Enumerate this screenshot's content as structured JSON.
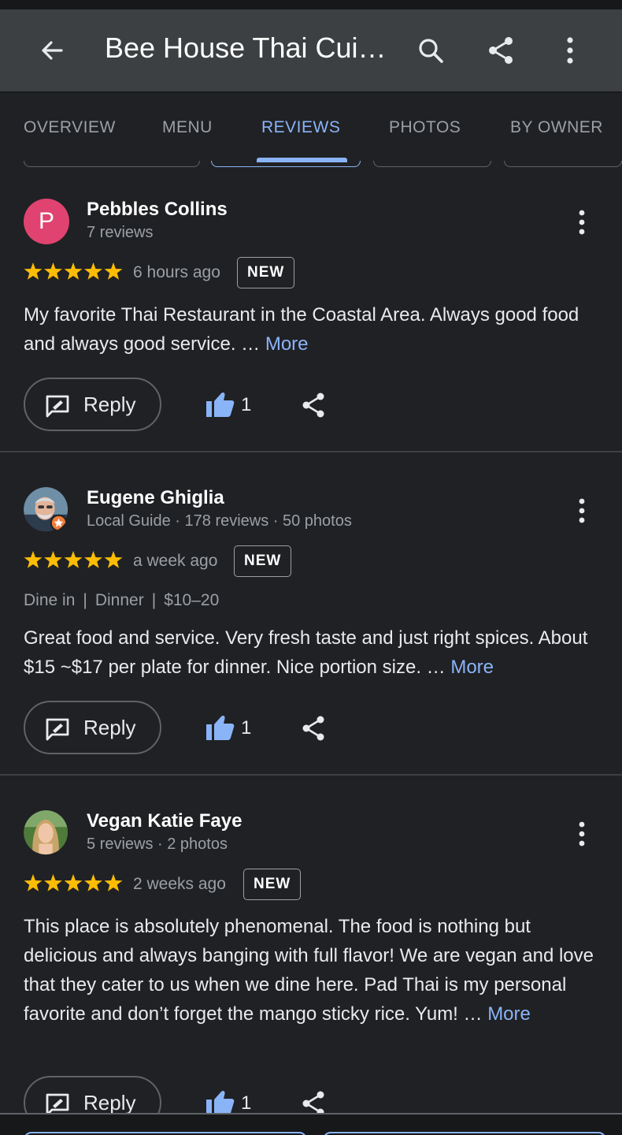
{
  "header": {
    "title": "Bee House Thai Cui…",
    "back_icon": "arrow-back-icon",
    "actions": [
      "search-icon",
      "share-icon",
      "more-vert-icon"
    ]
  },
  "tabs": [
    {
      "label": "OVERVIEW",
      "active": false
    },
    {
      "label": "MENU",
      "active": false
    },
    {
      "label": "REVIEWS",
      "active": true
    },
    {
      "label": "PHOTOS",
      "active": false
    },
    {
      "label": "BY OWNER",
      "active": false
    }
  ],
  "colors": {
    "accent": "#8ab4f8",
    "star": "#fbbc04",
    "avatar_p": "#e0436f",
    "background": "#202124",
    "appbar": "#3c4043"
  },
  "reviews": [
    {
      "avatar_letter": "P",
      "name": "Pebbles Collins",
      "meta": "7 reviews",
      "rating": 5,
      "time": "6 hours ago",
      "badge": "NEW",
      "text": "My favorite Thai Restaurant in the Coastal Area. Always good food and always good service. …",
      "more": "More",
      "reply_label": "Reply",
      "likes": "1"
    },
    {
      "name": "Eugene Ghiglia",
      "meta": "Local Guide · 178 reviews · 50 photos",
      "rating": 5,
      "time": "a week ago",
      "badge": "NEW",
      "tags": [
        "Dine in",
        "Dinner",
        "$10–20"
      ],
      "text": "Great food and service. Very fresh taste and just right spices. About $15 ~$17 per plate for dinner. Nice portion size. …",
      "more": "More",
      "reply_label": "Reply",
      "likes": "1"
    },
    {
      "name": "Vegan Katie Faye",
      "meta": "5 reviews · 2 photos",
      "rating": 5,
      "time": "2 weeks ago",
      "badge": "NEW",
      "text": "This place is absolutely phenomenal. The food is nothing but delicious and always banging with full flavor! We are vegan and love that they cater to us when we dine here. Pad Thai is my personal favorite and don’t forget the mango sticky rice. Yum! …",
      "more": "More",
      "reply_label": "Reply",
      "likes": "1"
    }
  ],
  "tag_separator": "|"
}
